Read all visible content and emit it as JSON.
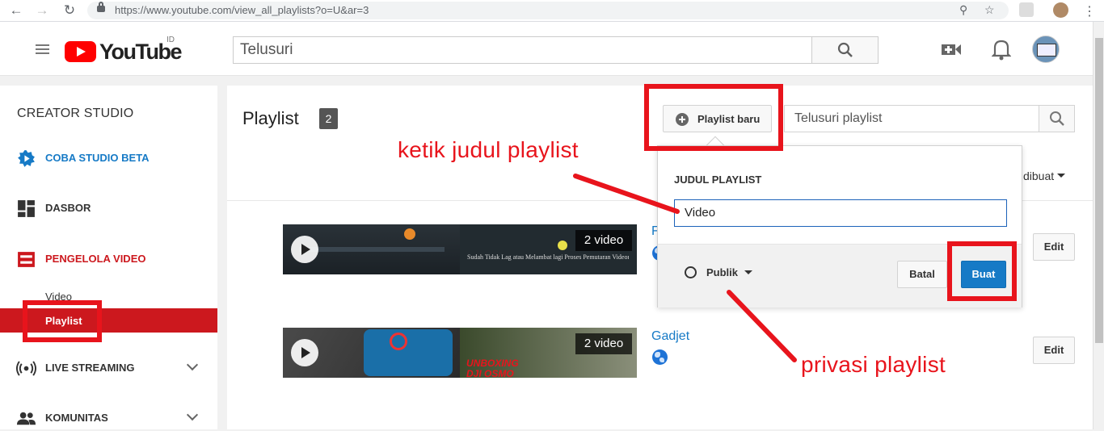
{
  "browser": {
    "url_host": "https://www.youtube.com",
    "url_path": "/view_all_playlists?o=U&ar=3"
  },
  "header": {
    "logo_text": "YouTube",
    "country_code": "ID",
    "search_placeholder": "Telusuri"
  },
  "sidebar": {
    "title": "CREATOR STUDIO",
    "items": [
      {
        "label": "COBA STUDIO BETA",
        "icon": "gear-icon",
        "color": "#167ac6"
      },
      {
        "label": "DASBOR",
        "icon": "dashboard-icon",
        "color": "#333333"
      },
      {
        "label": "PENGELOLA VIDEO",
        "icon": "video-manager-icon",
        "color": "#cc181e"
      },
      {
        "label": "LIVE STREAMING",
        "icon": "live-icon",
        "color": "#333333"
      },
      {
        "label": "KOMUNITAS",
        "icon": "community-icon",
        "color": "#333333"
      }
    ],
    "sub_items": [
      "Video",
      "Playlist"
    ]
  },
  "main": {
    "title": "Playlist",
    "count": "2",
    "new_playlist_label": "Playlist baru",
    "search_placeholder": "Telusuri playlist",
    "sort_label": "dibuat",
    "playlists": [
      {
        "title": "F",
        "video_count": "2 video",
        "edit_label": "Edit",
        "caption": "Sudah Tidak Lag atau Melambat lagi Proses Pemutaran Videonya"
      },
      {
        "title": "Gadjet",
        "video_count": "2 video",
        "edit_label": "Edit",
        "caption": "UNBOXING DJI OSMO"
      }
    ]
  },
  "popup": {
    "label": "JUDUL PLAYLIST",
    "input_value": "Video",
    "privacy_label": "Publik",
    "cancel_label": "Batal",
    "create_label": "Buat"
  },
  "annotations": {
    "title_hint": "ketik judul playlist",
    "privacy_hint": "privasi playlist",
    "color": "#e8141c"
  }
}
